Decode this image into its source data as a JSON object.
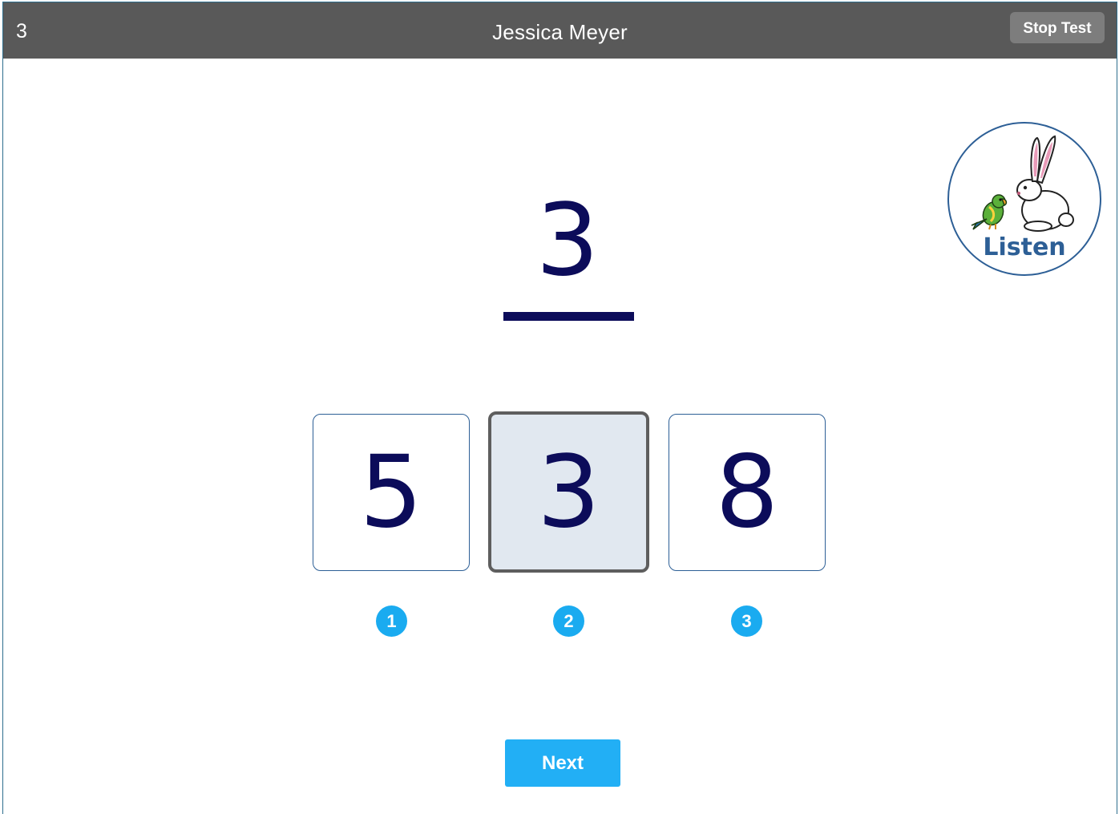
{
  "header": {
    "item_number": "3",
    "student_name": "Jessica Meyer",
    "stop_test_label": "Stop Test"
  },
  "listen_button": {
    "label": "Listen",
    "icon": "rabbit-and-parrot-icon"
  },
  "target": {
    "digit": "3"
  },
  "choices": [
    {
      "digit": "5",
      "badge": "1",
      "selected": false
    },
    {
      "digit": "3",
      "badge": "2",
      "selected": true
    },
    {
      "digit": "8",
      "badge": "3",
      "selected": false
    }
  ],
  "footer": {
    "next_label": "Next"
  },
  "colors": {
    "header_bg": "#595959",
    "digit_color": "#0c0c5a",
    "accent": "#22aff5",
    "listen_border": "#2d5f96",
    "selected_bg": "#e1e8f0"
  }
}
